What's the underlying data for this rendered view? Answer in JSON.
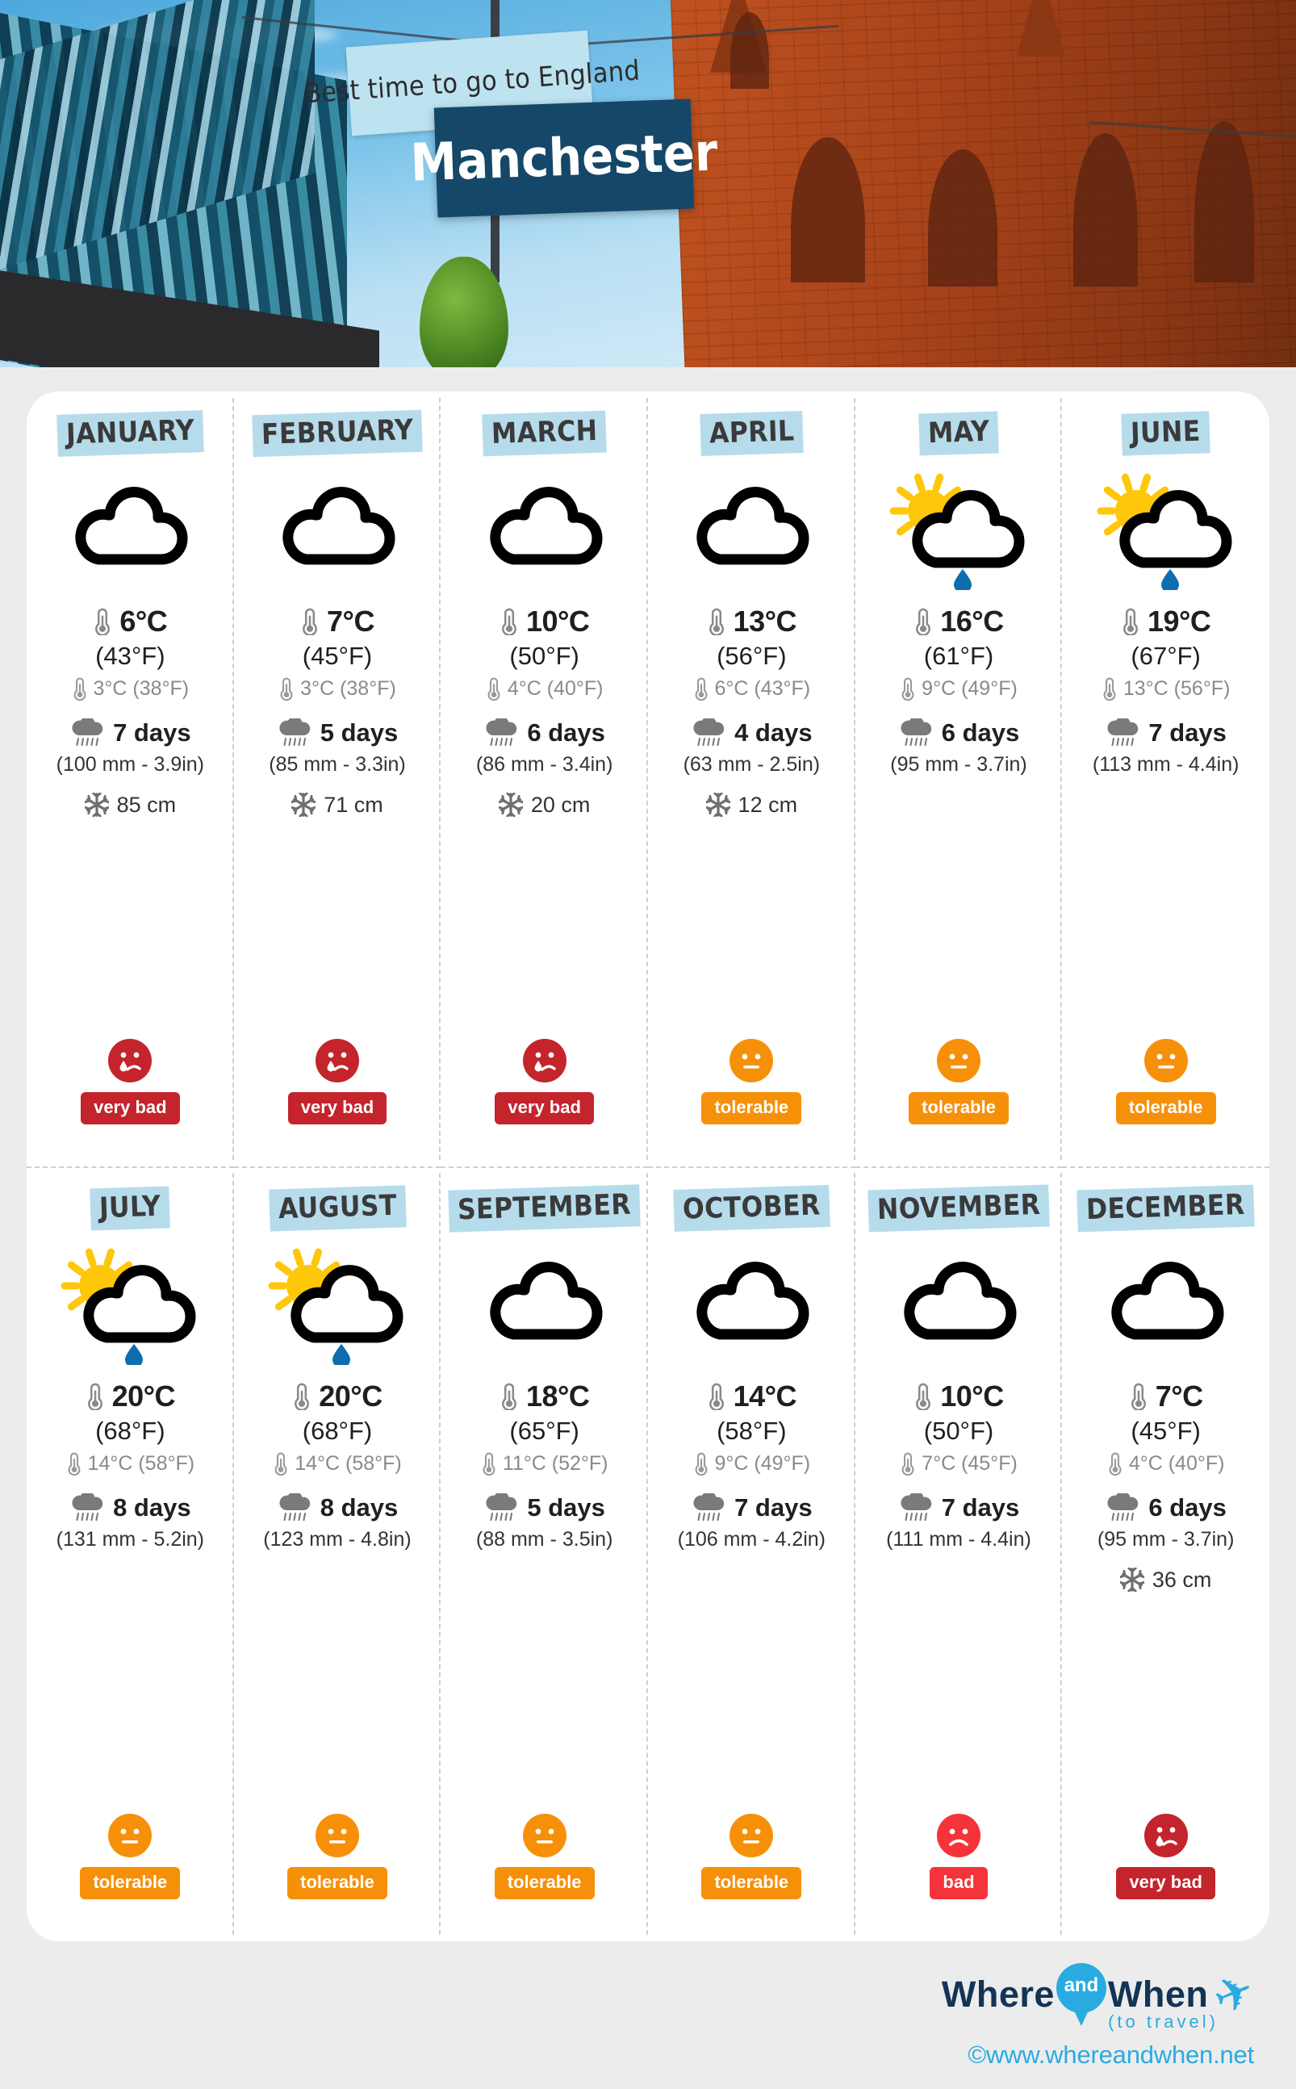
{
  "hero": {
    "subtitle": "Best time to go to England",
    "city": "Manchester"
  },
  "colors": {
    "month_tag_bg": "#b6dcec",
    "sign_main_bg": "#154868",
    "badge_very_bad": "#C4242B",
    "badge_bad": "#F5333A",
    "badge_tolerable": "#F79009",
    "sun": "#FFC70A",
    "raindrop": "#0E6DB0",
    "brand": "#29ABE2"
  },
  "icons": {
    "thermometer": "thermometer-icon",
    "rain_cloud": "rain-cloud-icon",
    "snowflake": "snowflake-icon",
    "cloud": "cloud-icon",
    "sun_cloud_rain": "sun-cloud-rain-icon"
  },
  "months": [
    {
      "name": "JANUARY",
      "weather_icon": "cloud",
      "high_c": "6°C",
      "high_f": "(43°F)",
      "low": "3°C (38°F)",
      "rain_days": "7 days",
      "rain_mm": "(100 mm - 3.9in)",
      "snow": "85 cm",
      "verdict": "very bad",
      "verdict_class": "verybad",
      "smiley": "sad-tear"
    },
    {
      "name": "FEBRUARY",
      "weather_icon": "cloud",
      "high_c": "7°C",
      "high_f": "(45°F)",
      "low": "3°C (38°F)",
      "rain_days": "5 days",
      "rain_mm": "(85 mm - 3.3in)",
      "snow": "71 cm",
      "verdict": "very bad",
      "verdict_class": "verybad",
      "smiley": "sad-tear"
    },
    {
      "name": "MARCH",
      "weather_icon": "cloud",
      "high_c": "10°C",
      "high_f": "(50°F)",
      "low": "4°C (40°F)",
      "rain_days": "6 days",
      "rain_mm": "(86 mm - 3.4in)",
      "snow": "20 cm",
      "verdict": "very bad",
      "verdict_class": "verybad",
      "smiley": "sad-tear"
    },
    {
      "name": "APRIL",
      "weather_icon": "cloud",
      "high_c": "13°C",
      "high_f": "(56°F)",
      "low": "6°C (43°F)",
      "rain_days": "4 days",
      "rain_mm": "(63 mm - 2.5in)",
      "snow": "12 cm",
      "verdict": "tolerable",
      "verdict_class": "tolerable",
      "smiley": "neutral"
    },
    {
      "name": "MAY",
      "weather_icon": "sun_cloud_rain",
      "high_c": "16°C",
      "high_f": "(61°F)",
      "low": "9°C (49°F)",
      "rain_days": "6 days",
      "rain_mm": "(95 mm - 3.7in)",
      "snow": "",
      "verdict": "tolerable",
      "verdict_class": "tolerable",
      "smiley": "neutral"
    },
    {
      "name": "JUNE",
      "weather_icon": "sun_cloud_rain",
      "high_c": "19°C",
      "high_f": "(67°F)",
      "low": "13°C (56°F)",
      "rain_days": "7 days",
      "rain_mm": "(113 mm - 4.4in)",
      "snow": "",
      "verdict": "tolerable",
      "verdict_class": "tolerable",
      "smiley": "neutral"
    },
    {
      "name": "JULY",
      "weather_icon": "sun_cloud_rain",
      "high_c": "20°C",
      "high_f": "(68°F)",
      "low": "14°C (58°F)",
      "rain_days": "8 days",
      "rain_mm": "(131 mm - 5.2in)",
      "snow": "",
      "verdict": "tolerable",
      "verdict_class": "tolerable",
      "smiley": "neutral"
    },
    {
      "name": "AUGUST",
      "weather_icon": "sun_cloud_rain",
      "high_c": "20°C",
      "high_f": "(68°F)",
      "low": "14°C (58°F)",
      "rain_days": "8 days",
      "rain_mm": "(123 mm - 4.8in)",
      "snow": "",
      "verdict": "tolerable",
      "verdict_class": "tolerable",
      "smiley": "neutral"
    },
    {
      "name": "SEPTEMBER",
      "weather_icon": "cloud",
      "high_c": "18°C",
      "high_f": "(65°F)",
      "low": "11°C (52°F)",
      "rain_days": "5 days",
      "rain_mm": "(88 mm - 3.5in)",
      "snow": "",
      "verdict": "tolerable",
      "verdict_class": "tolerable",
      "smiley": "neutral"
    },
    {
      "name": "OCTOBER",
      "weather_icon": "cloud",
      "high_c": "14°C",
      "high_f": "(58°F)",
      "low": "9°C (49°F)",
      "rain_days": "7 days",
      "rain_mm": "(106 mm - 4.2in)",
      "snow": "",
      "verdict": "tolerable",
      "verdict_class": "tolerable",
      "smiley": "neutral"
    },
    {
      "name": "NOVEMBER",
      "weather_icon": "cloud",
      "high_c": "10°C",
      "high_f": "(50°F)",
      "low": "7°C (45°F)",
      "rain_days": "7 days",
      "rain_mm": "(111 mm - 4.4in)",
      "snow": "",
      "verdict": "bad",
      "verdict_class": "bad",
      "smiley": "sad"
    },
    {
      "name": "DECEMBER",
      "weather_icon": "cloud",
      "high_c": "7°C",
      "high_f": "(45°F)",
      "low": "4°C (40°F)",
      "rain_days": "6 days",
      "rain_mm": "(95 mm - 3.7in)",
      "snow": "36 cm",
      "verdict": "very bad",
      "verdict_class": "verybad",
      "smiley": "sad-tear"
    }
  ],
  "footer": {
    "logo_where": "Where",
    "logo_and": "and",
    "logo_when": "When",
    "logo_tagline": "(to travel)",
    "url": "©www.whereandwhen.net"
  }
}
